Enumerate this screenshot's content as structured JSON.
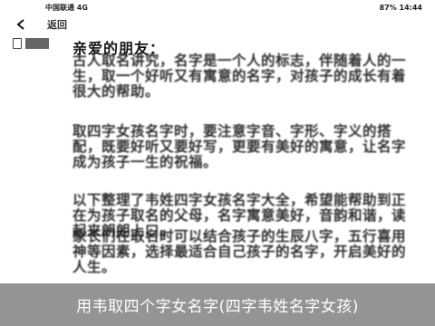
{
  "status_bar": {
    "left": "中国联通 4G",
    "right": "87% 14:44"
  },
  "nav": {
    "back_icon": "chevron-left-icon",
    "title": "返回"
  },
  "article": {
    "greeting": "亲爱的朋友：",
    "paragraphs": [
      "古人取名讲究，名字是一个人的标志，伴随着人的一生，取一个好听又有寓意的名字，对孩子的成长有着很大的帮助。",
      "取四字女孩名字时，要注意字音、字形、字义的搭配，既要好听又要好写，更要有美好的寓意，让名字成为孩子一生的祝福。",
      "以下整理了韦姓四字女孩名字大全，希望能帮助到正在为孩子取名的父母，名字寓意美好，音韵和谐，读起来朗朗上口。",
      "家长们在取名时可以结合孩子的生辰八字，五行喜用神等因素，选择最适合自己孩子的名字，开启美好的人生。"
    ]
  },
  "side_button": {
    "icon": "document-icon"
  },
  "caption": "用韦取四个字女名字(四字韦姓名字女孩)"
}
